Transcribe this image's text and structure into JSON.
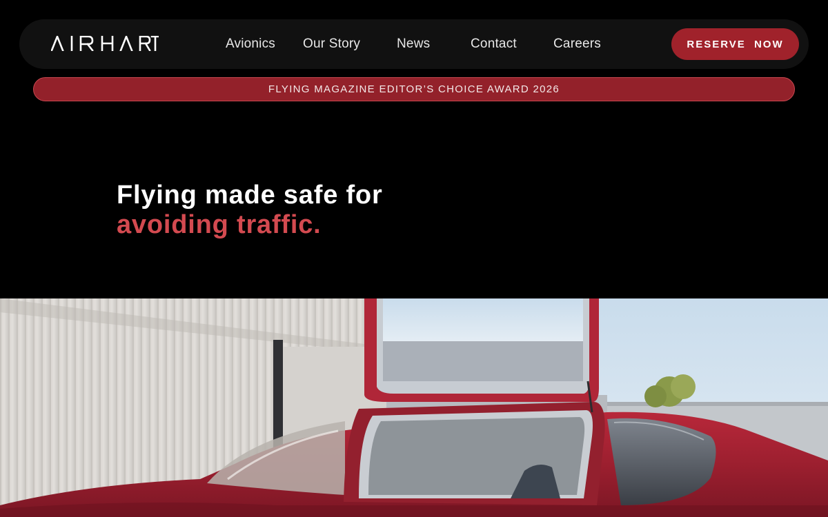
{
  "brand": {
    "logo_text": "AIRHART"
  },
  "nav": {
    "links": [
      {
        "label": "Avionics"
      },
      {
        "label": "Our Story"
      },
      {
        "label": "News"
      },
      {
        "label": "Contact"
      },
      {
        "label": "Careers"
      }
    ],
    "cta_label": "RESERVE NOW"
  },
  "banner": {
    "text": "FLYING MAGAZINE EDITOR’S CHOICE AWARD 2026"
  },
  "hero": {
    "headline_line1": "Flying made safe for",
    "headline_line2": "avoiding traffic."
  },
  "colors": {
    "background": "#000000",
    "nav_background": "#111111",
    "accent_red": "#a0222b",
    "banner_red": "#93212a",
    "headline_highlight": "#d34a50"
  },
  "icons": {
    "logo": "airhart-wordmark"
  }
}
